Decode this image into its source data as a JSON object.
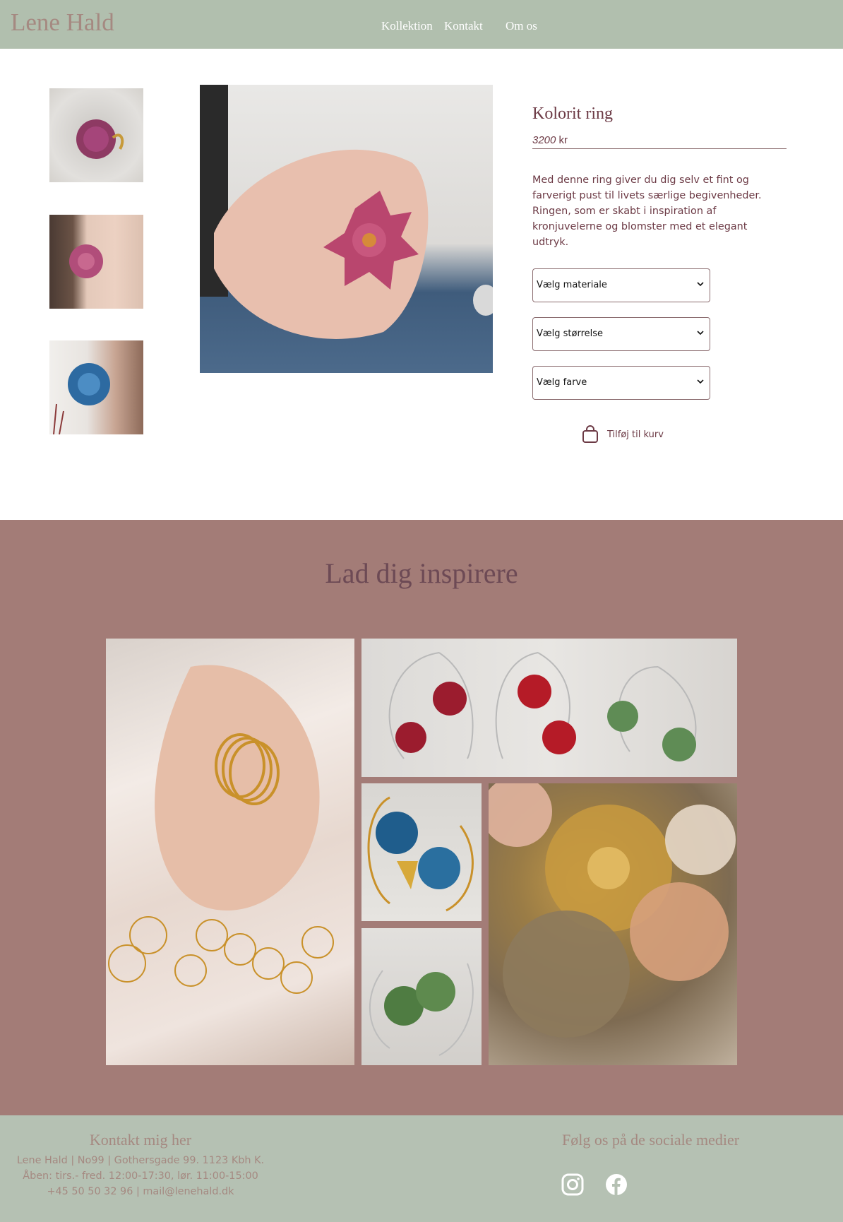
{
  "header": {
    "brand": "Lene Hald",
    "nav": [
      "Kollektion",
      "Kontakt",
      "Om os"
    ]
  },
  "product": {
    "title": "Kolorit ring",
    "price_value": "3200",
    "price_unit": "kr",
    "description": "Med denne ring giver du dig selv et fint og farverigt pust til livets særlige begivenheder. Ringen, som er skabt i inspiration af kronjuvelerne og blomster med et elegant udtryk.",
    "selects": [
      "Vælg materiale",
      "Vælg størrelse",
      "Vælg farve"
    ],
    "add_to_cart": "Tilføj til kurv"
  },
  "inspiration": {
    "title": "Lad dig inspirere"
  },
  "footer": {
    "contact_title": "Kontakt mig her",
    "contact_lines": [
      "Lene Hald | No99 | Gothersgade 99. 1123 Kbh K.",
      "Åben: tirs.- fred. 12:00-17:30, lør. 11:00-15:00",
      "+45 50 50 32 96 | mail@lenehald.dk"
    ],
    "social_title": "Følg os på de sociale medier",
    "social_icons": [
      "instagram-icon",
      "facebook-icon"
    ]
  },
  "colors": {
    "header_bg": "#b1bfae",
    "brand_text": "#a58981",
    "accent_text": "#6c3a45",
    "inspire_bg": "#a37c77",
    "footer_bg": "#b5c1b3"
  }
}
